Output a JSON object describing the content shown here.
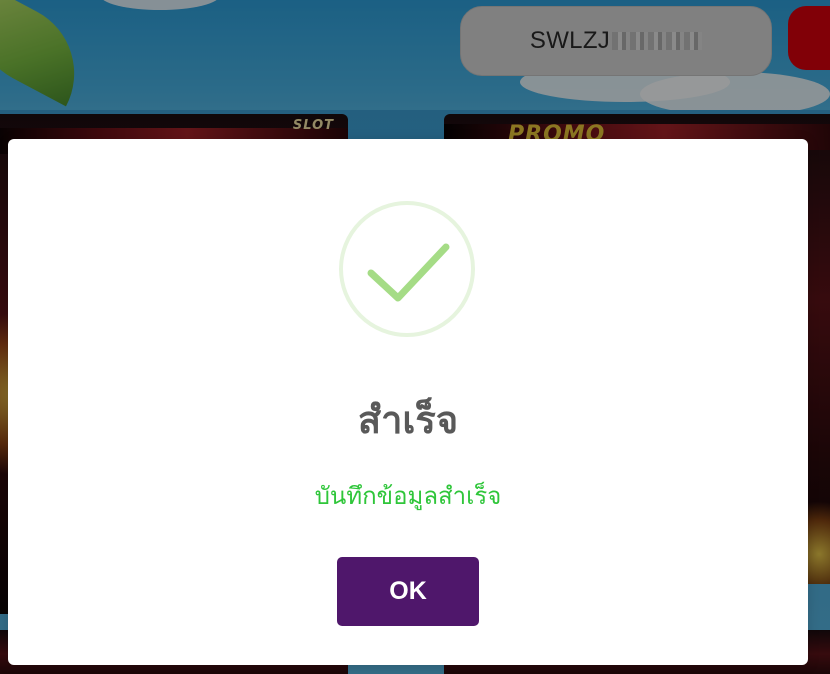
{
  "header": {
    "username_visible": "SWLZJ",
    "username_masked": true
  },
  "game_cards": [
    {
      "badge": "SLOT"
    },
    {
      "badge": "PROMO"
    }
  ],
  "dialog": {
    "icon": "success-check-icon",
    "title": "สำเร็จ",
    "message": "บันทึกข้อมูลสำเร็จ",
    "confirm_label": "OK"
  },
  "colors": {
    "confirm_button": "#4f176b",
    "message_text": "#2fc63a",
    "check_mark": "#a5dc86",
    "check_ring": "#e6f4de",
    "title_text": "#595959",
    "logout_button": "#d8000c"
  }
}
